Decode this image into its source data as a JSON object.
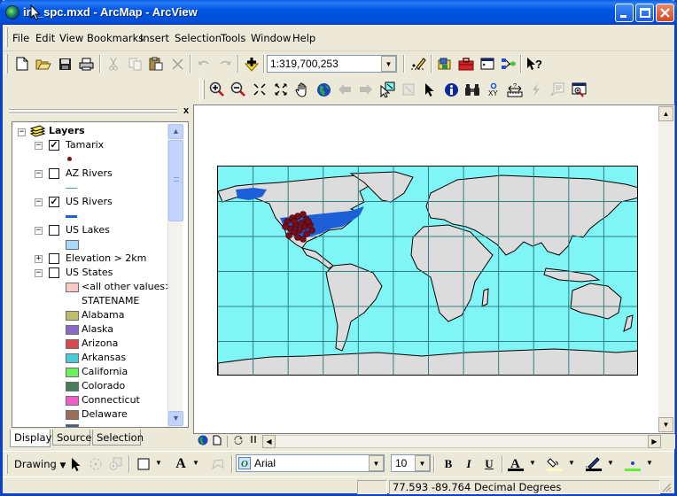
{
  "window": {
    "title": "irk_spc.mxd - ArcMap - ArcView",
    "controls": {
      "minimize": "minimize",
      "maximize": "maximize",
      "close": "close"
    }
  },
  "menu": [
    {
      "label": "File",
      "mnemonic": "F"
    },
    {
      "label": "Edit",
      "mnemonic": "E"
    },
    {
      "label": "View",
      "mnemonic": "V"
    },
    {
      "label": "Bookmarks",
      "mnemonic": "B"
    },
    {
      "label": "Insert",
      "mnemonic": "I"
    },
    {
      "label": "Selection",
      "mnemonic": "S"
    },
    {
      "label": "Tools",
      "mnemonic": "T"
    },
    {
      "label": "Window",
      "mnemonic": "W"
    },
    {
      "label": "Help",
      "mnemonic": "H"
    }
  ],
  "standard_toolbar": {
    "buttons": [
      "new-document",
      "open",
      "save",
      "print",
      "cut",
      "copy",
      "paste",
      "delete",
      "undo",
      "redo",
      "add-data"
    ],
    "scale": "1:319,700,253",
    "tail_buttons": [
      "editor-toolbar",
      "arccatalog",
      "arctoolbox",
      "command-line",
      "modelbuilder",
      "whats-this-help"
    ]
  },
  "tools_toolbar": {
    "buttons": [
      "zoom-in",
      "zoom-out",
      "fixed-zoom-in",
      "fixed-zoom-out",
      "pan",
      "full-extent",
      "back-extent",
      "forward-extent",
      "select-features",
      "clear-selection",
      "select-elements",
      "identify",
      "find",
      "go-to-xy",
      "measure",
      "hyperlink",
      "html-popup",
      "magnifier-window"
    ]
  },
  "toc": {
    "close_label": "x",
    "root": "Layers",
    "layers": [
      {
        "name": "Tamarix",
        "checked": true,
        "expanded": true,
        "symbol": "point",
        "color": "#7a0c18"
      },
      {
        "name": "AZ Rivers",
        "checked": false,
        "expanded": true,
        "symbol": "line-thin",
        "color": "#5a8fd8"
      },
      {
        "name": "US Rivers",
        "checked": true,
        "expanded": true,
        "symbol": "line-thick",
        "color": "#1d5fd6"
      },
      {
        "name": "US Lakes",
        "checked": false,
        "expanded": true,
        "symbol": "polygon",
        "color": "#a6dcf7"
      },
      {
        "name": "Elevation > 2km",
        "checked": false,
        "expanded": false
      },
      {
        "name": "US States",
        "checked": false,
        "expanded": true
      }
    ],
    "us_states_legend": {
      "other": {
        "label": "<all other values>",
        "color": "#f6cbc3"
      },
      "field": "STATENAME",
      "values": [
        {
          "label": "Alabama",
          "color": "#bcbe6a"
        },
        {
          "label": "Alaska",
          "color": "#8a6ac4"
        },
        {
          "label": "Arizona",
          "color": "#d84a4f"
        },
        {
          "label": "Arkansas",
          "color": "#4ccad8"
        },
        {
          "label": "California",
          "color": "#6cf060"
        },
        {
          "label": "Colorado",
          "color": "#4b7c5a"
        },
        {
          "label": "Connecticut",
          "color": "#ec5fc8"
        },
        {
          "label": "Delaware",
          "color": "#9c6e5a"
        }
      ]
    },
    "tabs": [
      {
        "label": "Display",
        "active": true
      },
      {
        "label": "Source",
        "active": false
      },
      {
        "label": "Selection",
        "active": false
      }
    ]
  },
  "map": {
    "ocean_color": "#7ff6f5",
    "land_color": "#dcdcdc",
    "grid_color": "#2f7f82",
    "rivers_color": "#1d5fd6",
    "points_color": "#7a0c18",
    "view_buttons": [
      "data-view",
      "layout-view",
      "refresh",
      "pause-drawing"
    ]
  },
  "drawing_toolbar": {
    "menu_label": "Drawing",
    "font": "Arial",
    "size": "10",
    "bold": "B",
    "italic": "I",
    "underline": "U",
    "font_color": "#000000",
    "fill_color": "#fff8c0",
    "line_color": "#000000",
    "marker_color": "#5ef03a"
  },
  "status": {
    "coordinates": "77.593  -89.764 Decimal Degrees"
  }
}
